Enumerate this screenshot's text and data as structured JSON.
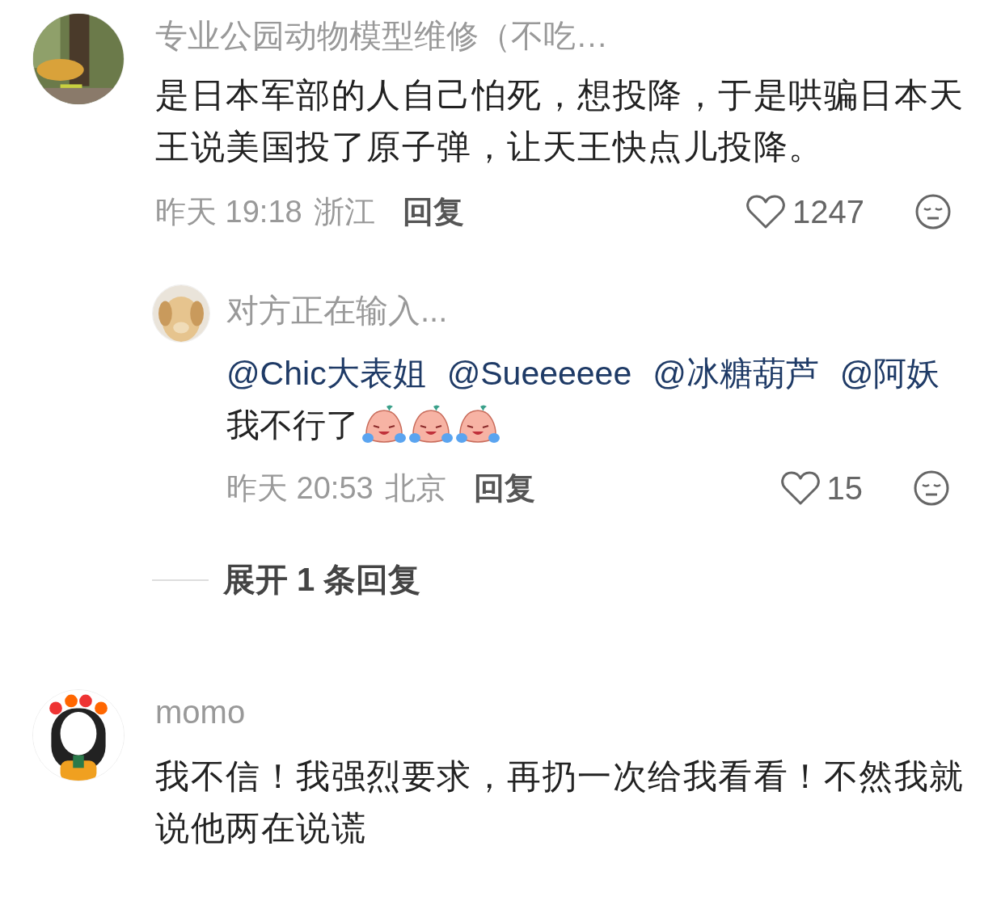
{
  "comments": [
    {
      "author": "专业公园动物模型维修（不吃…",
      "avatar": {
        "kind": "picture"
      },
      "text": "是日本军部的人自己怕死，想投降，于是哄骗日本天王说美国投了原子弹，让天王快点儿投降。",
      "time": "昨天 19:18",
      "location": "浙江",
      "reply_label": "回复",
      "likes": "1247",
      "liked": false,
      "replies": [
        {
          "author": "对方正在输入...",
          "avatar": {
            "kind": "picture"
          },
          "segments": [
            {
              "kind": "mention",
              "text": "@Chic大表姐"
            },
            {
              "kind": "mention",
              "text": "@Sueeeeee"
            },
            {
              "kind": "mention",
              "text": "@冰糖葫芦"
            },
            {
              "kind": "mention",
              "text": "@阿妖"
            },
            {
              "kind": "text",
              "text": "我不行了"
            },
            {
              "kind": "emoji"
            },
            {
              "kind": "emoji"
            },
            {
              "kind": "emoji"
            }
          ],
          "time": "昨天 20:53",
          "location": "北京",
          "reply_label": "回复",
          "likes": "15",
          "liked": false
        }
      ],
      "expand_label": "展开 1 条回复"
    },
    {
      "author": "momo",
      "avatar": {
        "kind": "picture"
      },
      "text": "我不信！我强烈要求，再扔一次给我看看！不然我就说他两在说谎"
    }
  ]
}
